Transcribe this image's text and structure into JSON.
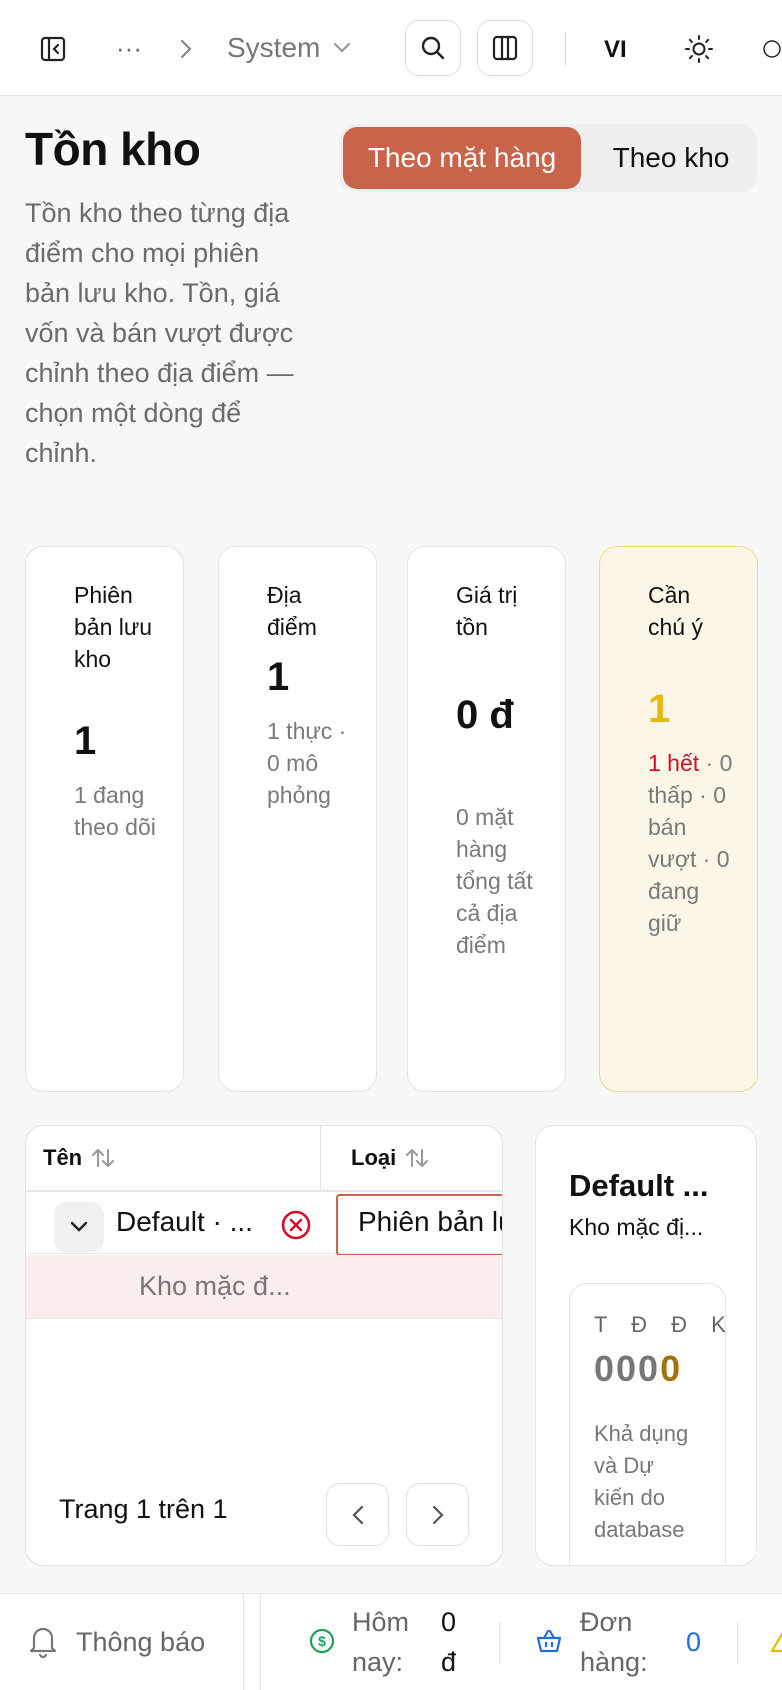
{
  "topbar": {
    "breadcrumb_ellipsis": "···",
    "breadcrumb_current": "System",
    "language": "VI"
  },
  "header": {
    "title": "Tồn kho",
    "description": "Tồn kho theo từng địa điểm cho mọi phiên bản lưu kho. Tồn, giá vốn và bán vượt được chỉnh theo địa điểm — chọn một dòng để chỉnh.",
    "view_toggle": {
      "by_item": "Theo mặt hàng",
      "by_warehouse": "Theo kho",
      "selected": "by_item"
    }
  },
  "stats": [
    {
      "label": "Phiên bản lưu kho",
      "value": "1",
      "sub": "1 đang theo dõi"
    },
    {
      "label": "Địa điểm",
      "value": "1",
      "sub": "1 thực · 0 mô phỏng"
    },
    {
      "label": "Giá trị tồn",
      "value": "0 đ",
      "sub": "0 mặt hàng tổng tất cả địa điểm"
    },
    {
      "label": "Cần chú ý",
      "value": "1",
      "sub_alert": "1 hết",
      "sub": "· 0 thấp · 0 bán vượt · 0 đang giữ"
    }
  ],
  "table": {
    "columns": [
      "Tên",
      "Loại"
    ],
    "rows": [
      {
        "name": "Default · ...",
        "type": "Phiên bản lưu kho"
      }
    ],
    "expanded_location": "Kho mặc đ...",
    "pagination": "Trang 1 trên 1"
  },
  "detail": {
    "title": "Default ...",
    "subtitle": "Kho mặc đị...",
    "letters": "T Đ Đ K",
    "digits": "000",
    "digit_highlight": "0",
    "description": "Khả dụng và Dự kiến do database"
  },
  "bottombar": {
    "notifications": "Thông báo",
    "today_label": "Hôm nay:",
    "today_value": "0 đ",
    "orders_label": "Đơn hàng:",
    "orders_value": "0"
  },
  "colors": {
    "accent": "#c9634a",
    "warning_value": "#e8b80c",
    "alert_red": "#d0112b",
    "gold_digit": "#a6710c",
    "money_green": "#1aa25a",
    "orders_blue": "#1d6fe0"
  }
}
